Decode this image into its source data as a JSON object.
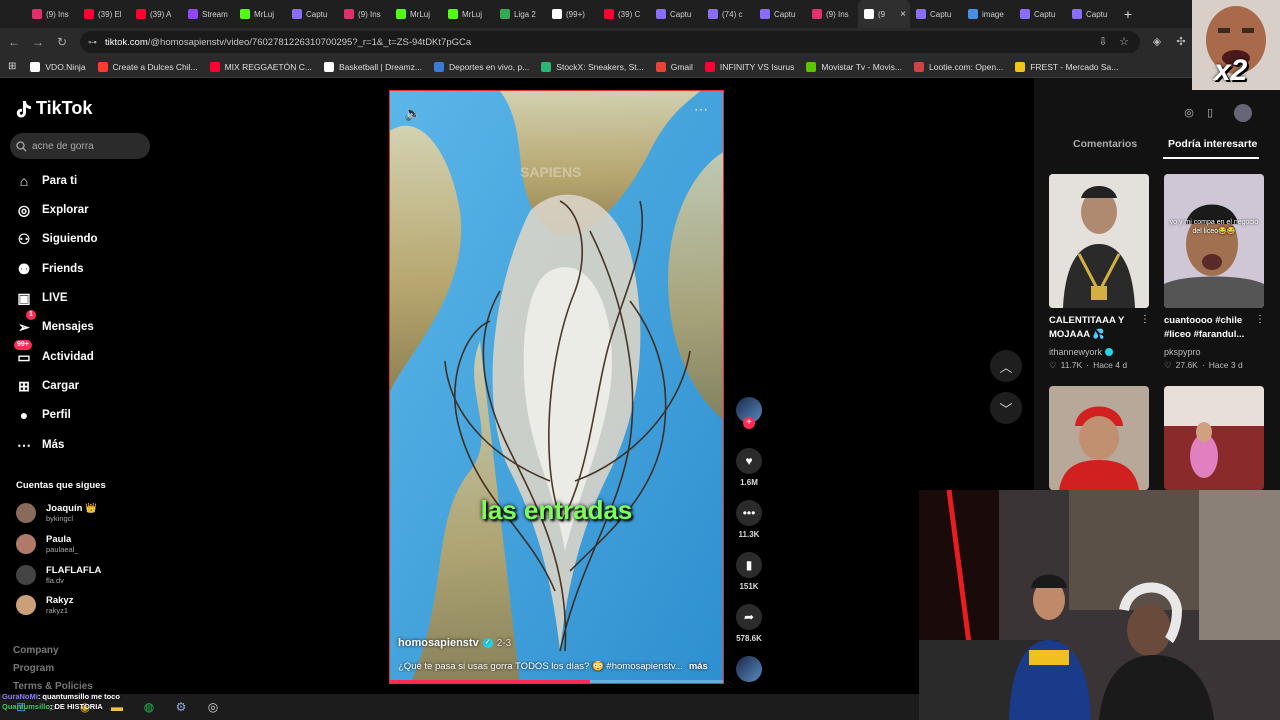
{
  "browser": {
    "tabs": [
      {
        "label": "(9) Ins",
        "color": "#e1306c"
      },
      {
        "label": "(39) El",
        "color": "#ff0033"
      },
      {
        "label": "(39) A",
        "color": "#ff0033"
      },
      {
        "label": "Stream",
        "color": "#9146ff"
      },
      {
        "label": "MrLuj",
        "color": "#53fc18"
      },
      {
        "label": "Captu",
        "color": "#8a6cff"
      },
      {
        "label": "(9) Ins",
        "color": "#e1306c"
      },
      {
        "label": "MrLuj",
        "color": "#53fc18"
      },
      {
        "label": "MrLuj",
        "color": "#53fc18"
      },
      {
        "label": "Liga 2",
        "color": "#34a853"
      },
      {
        "label": "(99+)",
        "color": "#ffffff"
      },
      {
        "label": "(39) C",
        "color": "#ff0033"
      },
      {
        "label": "Captu",
        "color": "#8a6cff"
      },
      {
        "label": "(74) c",
        "color": "#8a6cff"
      },
      {
        "label": "Captu",
        "color": "#8a6cff"
      },
      {
        "label": "(9) Ins",
        "color": "#e1306c"
      },
      {
        "label": "(9",
        "color": "#ffffff",
        "active": true
      },
      {
        "label": "Captu",
        "color": "#8a6cff"
      },
      {
        "label": "image",
        "color": "#4a90e2"
      },
      {
        "label": "Captu",
        "color": "#8a6cff"
      },
      {
        "label": "Captu",
        "color": "#8a6cff"
      }
    ],
    "url_host": "tiktok.com",
    "url_path": "/@homosapienstv/video/7602781226310700295?_r=1&_t=ZS-94tDKt7pGCa",
    "bookmarks": [
      {
        "label": "VDO.Ninja",
        "color": "#ffffff"
      },
      {
        "label": "Create a Dulces Chil...",
        "color": "#ff3b30"
      },
      {
        "label": "MIX REGGAETÓN C...",
        "color": "#ff0033"
      },
      {
        "label": "Basketball | Dreamz...",
        "color": "#ffffff"
      },
      {
        "label": "Deportes en vivo, p...",
        "color": "#3a7bd5"
      },
      {
        "label": "StockX: Sneakers, St...",
        "color": "#2bb673"
      },
      {
        "label": "Gmail",
        "color": "#ea4335"
      },
      {
        "label": "INFINITY VS Isurus",
        "color": "#ff0033"
      },
      {
        "label": "Movistar Tv - Movis...",
        "color": "#5bc500"
      },
      {
        "label": "Lootie.com: Open...",
        "color": "#cc4444"
      },
      {
        "label": "FREST - Mercado Sa...",
        "color": "#f0c419"
      }
    ]
  },
  "sidebar": {
    "logo": "TikTok",
    "search_placeholder": "acne de gorra",
    "nav": [
      {
        "label": "Para ti",
        "icon": "home-icon",
        "glyph": "⌂"
      },
      {
        "label": "Explorar",
        "icon": "compass-icon",
        "glyph": "◎"
      },
      {
        "label": "Siguiendo",
        "icon": "following-icon",
        "glyph": "⚇"
      },
      {
        "label": "Friends",
        "icon": "friends-icon",
        "glyph": "⚉"
      },
      {
        "label": "LIVE",
        "icon": "live-icon",
        "glyph": "▣"
      },
      {
        "label": "Mensajes",
        "icon": "messages-icon",
        "glyph": "➢",
        "badge": "1"
      },
      {
        "label": "Actividad",
        "icon": "activity-icon",
        "glyph": "▭",
        "badge": "99+"
      },
      {
        "label": "Cargar",
        "icon": "upload-icon",
        "glyph": "⊞"
      },
      {
        "label": "Perfil",
        "icon": "profile-icon",
        "glyph": "●"
      },
      {
        "label": "Más",
        "icon": "more-icon",
        "glyph": "⋯"
      }
    ],
    "following_title": "Cuentas que sigues",
    "accounts": [
      {
        "name": "Joaquín 👑",
        "handle": "bykingcl",
        "color": "#8a6a5a"
      },
      {
        "name": "Paula",
        "handle": "paulaeal_",
        "color": "#b07a6a"
      },
      {
        "name": "FLAFLAFLA",
        "handle": "fla.dv",
        "color": "#444444"
      },
      {
        "name": "Rakyz",
        "handle": "rakyz1",
        "color": "#c9a07a"
      }
    ],
    "footer": [
      "Company",
      "Program",
      "Terms & Policies"
    ]
  },
  "video": {
    "caption": "las entradas",
    "author": "homosapienstv",
    "date": "2-3",
    "description": "¿Qué te pasa si usas gorra TODOS los días? 😳 #homosapienstv...",
    "more": "más",
    "progress": 0.6,
    "watermark": "SAPIENS"
  },
  "actions": {
    "likes": "1.6M",
    "comments": "11.3K",
    "saves": "151K",
    "shares": "578.6K"
  },
  "right_panel": {
    "tabs": [
      "Comentarios",
      "Podría interesarte"
    ],
    "active_tab": 1,
    "cards": [
      {
        "title": "CALENTITAAA Y MOJAAA 💦",
        "author": "ithannewyork",
        "verified": true,
        "likes": "11.7K",
        "age": "Hace 4 d",
        "overlay": ""
      },
      {
        "title": "cuantoooo #chile #liceo #farandul...",
        "author": "pkspypro",
        "verified": false,
        "likes": "27.6K",
        "age": "Hace 3 d",
        "overlay": "yo y mi compa en el negocio del liceo😂😂"
      }
    ]
  },
  "stream": {
    "meme_label": "x2",
    "chat": [
      {
        "user": "GuraNoMi",
        "msg": ": quantumsillo me toco"
      },
      {
        "user": "Quantumsillo",
        "msg": ": DE HISTORIA"
      }
    ]
  }
}
